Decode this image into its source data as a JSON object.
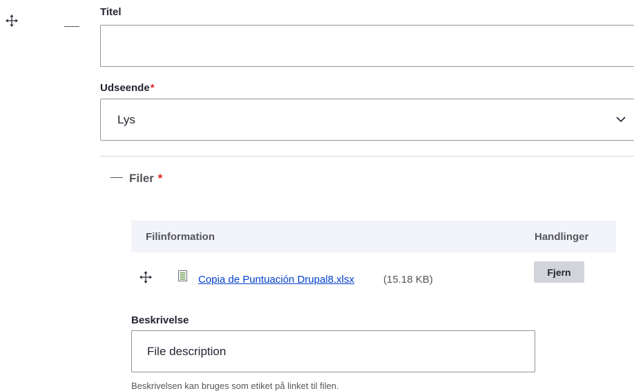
{
  "title_field": {
    "label": "Titel",
    "value": ""
  },
  "appearance_field": {
    "label": "Udseende",
    "required_mark": "*",
    "selected": "Lys"
  },
  "files_section": {
    "summary": "Filer",
    "required_mark": "*",
    "table": {
      "headers": [
        "Filinformation",
        "Handlinger"
      ],
      "rows": [
        {
          "file_name": "Copia de Puntuación Drupal8.xlsx",
          "file_size": "(15.18 KB)",
          "action": "Fjern"
        }
      ]
    }
  },
  "description_field": {
    "label": "Beskrivelse",
    "value": "File description",
    "help": "Beskrivelsen kan bruges som etiket på linket til filen."
  },
  "icons": {
    "drag": "move-arrows-icon",
    "file": "spreadsheet-file-icon",
    "chevron": "chevron-down-icon"
  },
  "colors": {
    "required": "#dc2323",
    "link": "#003ecc",
    "border": "#8e929c",
    "table_header_bg": "#f3f4f9",
    "button_bg": "#d3d4d9"
  }
}
